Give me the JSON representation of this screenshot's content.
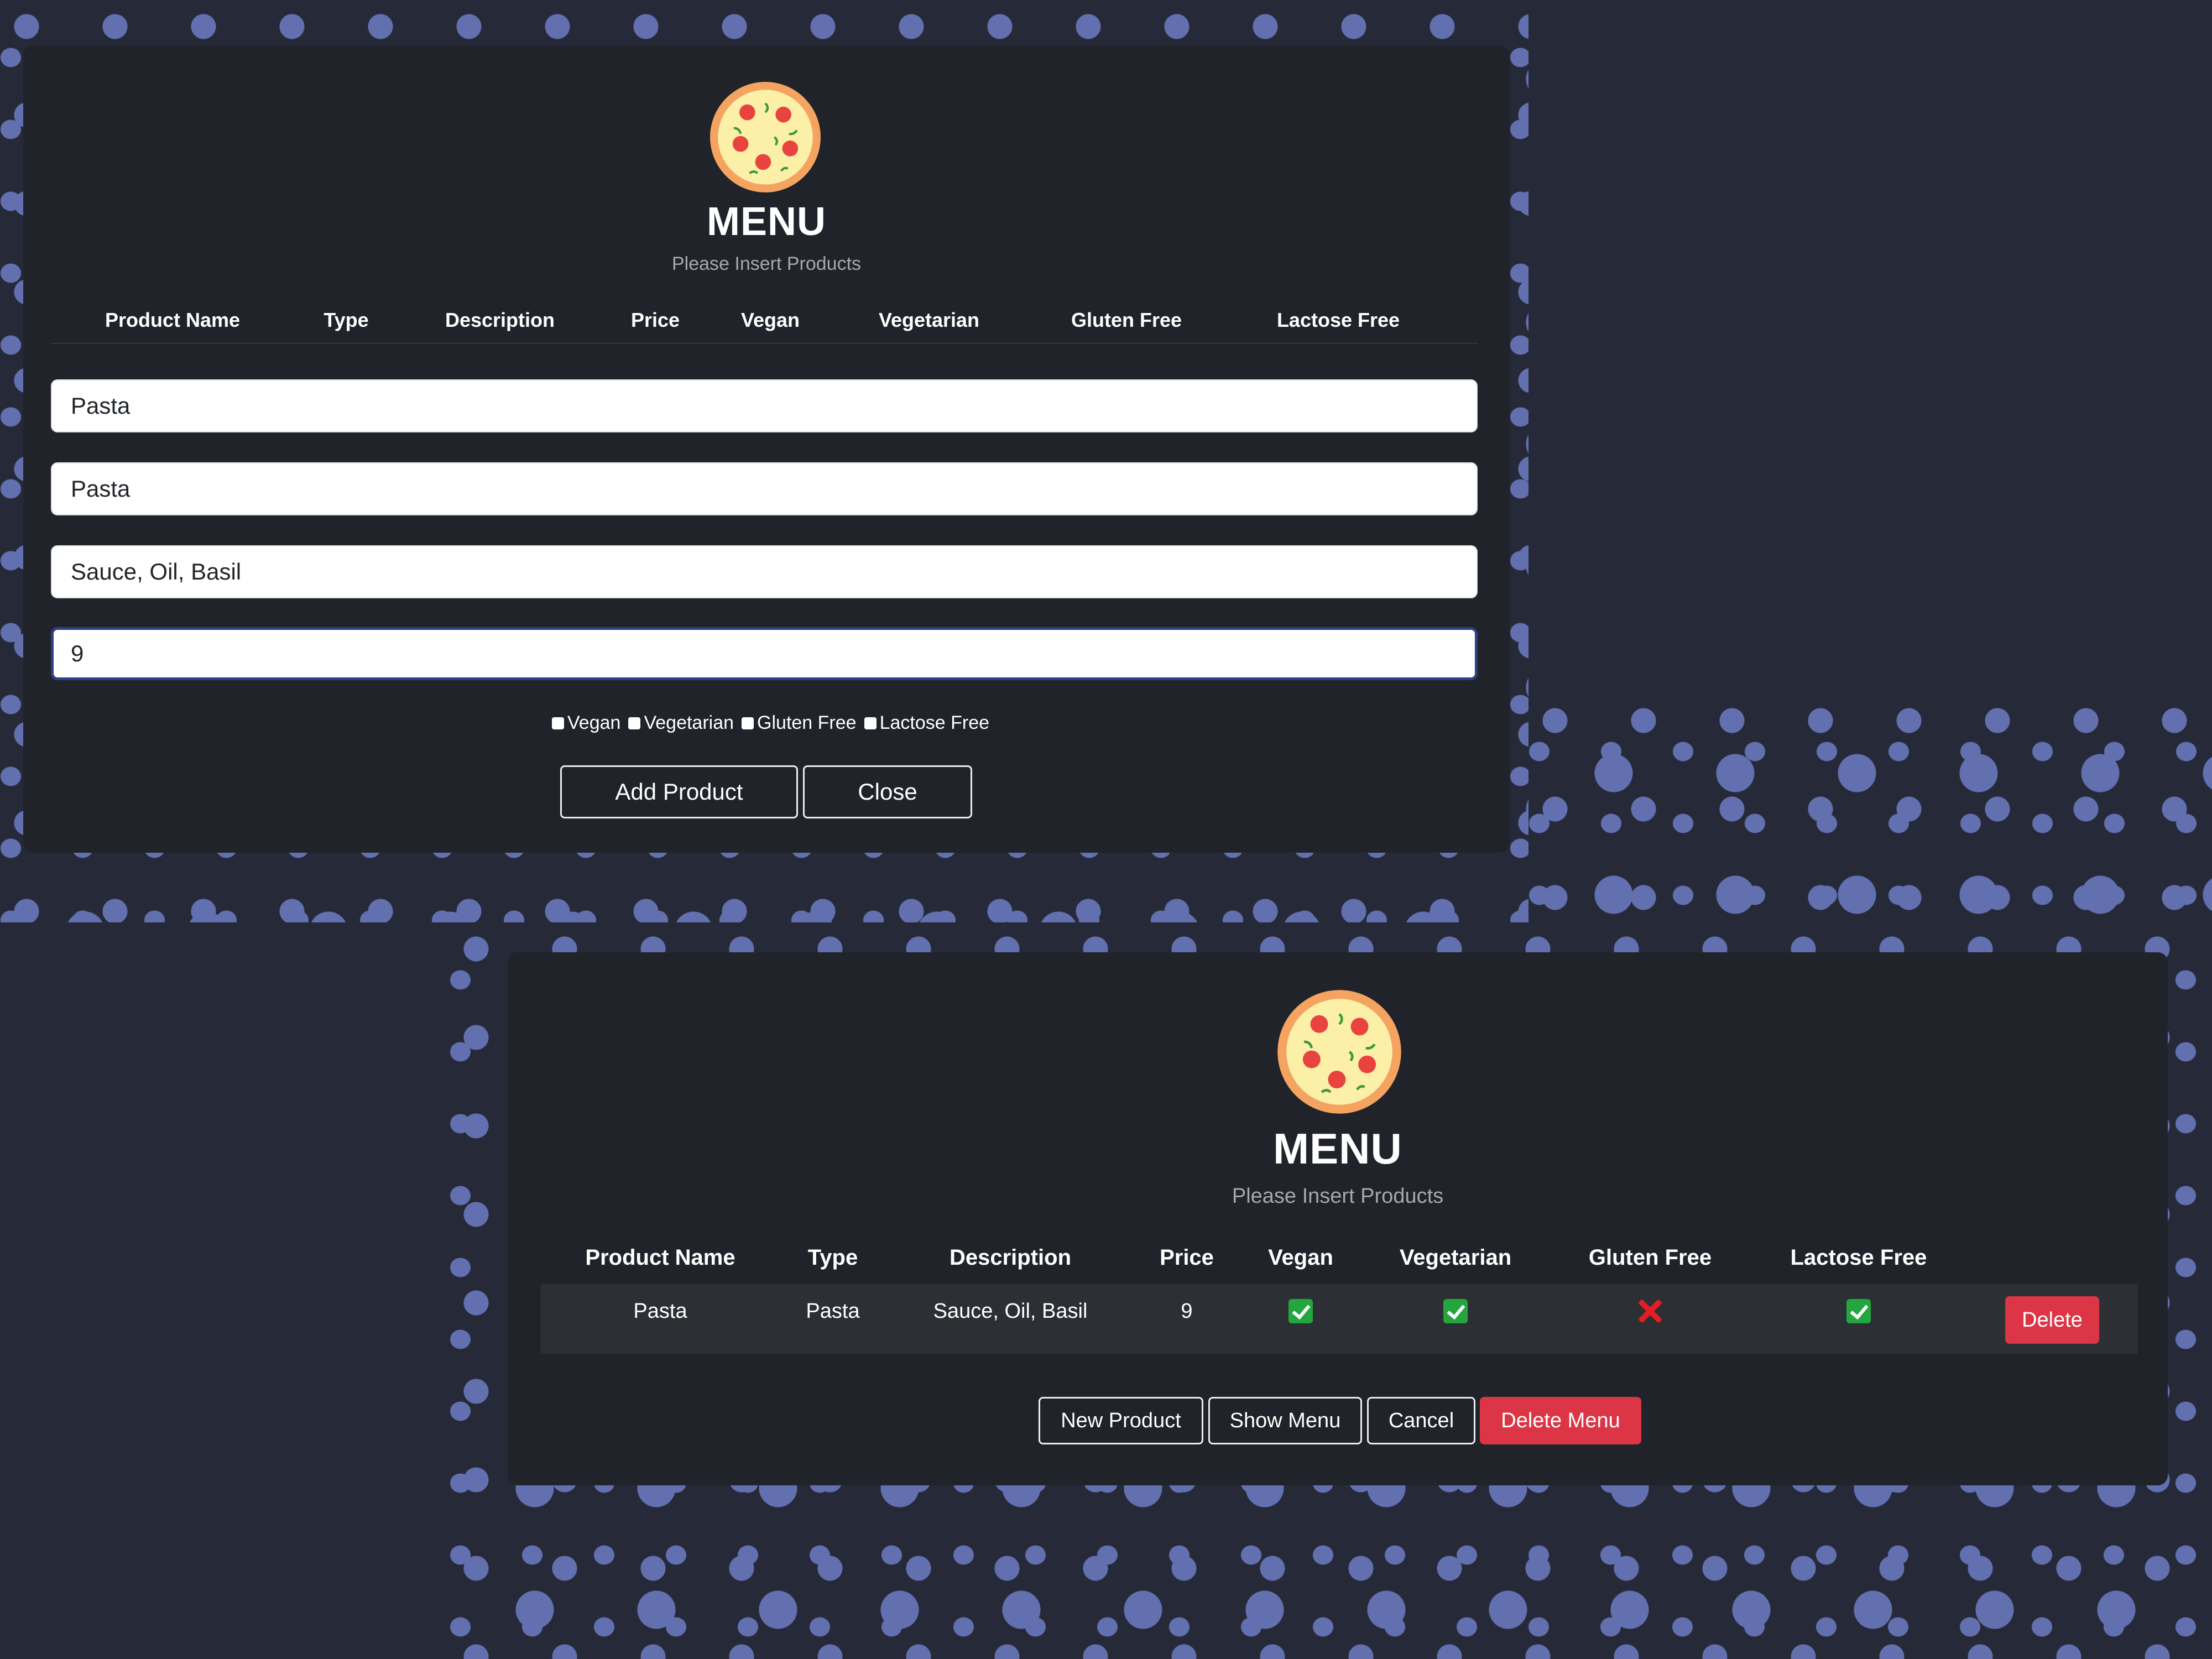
{
  "colors": {
    "page_background": "#262a38",
    "pattern": "#6270b0",
    "card": "#202329",
    "danger": "#dc3545",
    "focus_border": "#2e3f86",
    "check_green": "#24a63f",
    "cross_red": "#e31e24"
  },
  "add_form": {
    "logo_icon": "pizza-icon",
    "title": "MENU",
    "subtitle": "Please Insert Products",
    "headers": [
      "Product Name",
      "Type",
      "Description",
      "Price",
      "Vegan",
      "Vegetarian",
      "Gluten Free",
      "Lactose Free"
    ],
    "inputs": {
      "product_name": "Pasta",
      "type": "Pasta",
      "description": "Sauce, Oil, Basil",
      "price": "9"
    },
    "checkboxes": [
      {
        "label": "Vegan",
        "checked": false
      },
      {
        "label": "Vegetarian",
        "checked": false
      },
      {
        "label": "Gluten Free",
        "checked": false
      },
      {
        "label": "Lactose Free",
        "checked": false
      }
    ],
    "add_button": "Add Product",
    "close_button": "Close"
  },
  "menu_view": {
    "logo_icon": "pizza-icon",
    "title": "MENU",
    "subtitle": "Please Insert Products",
    "headers": [
      "Product Name",
      "Type",
      "Description",
      "Price",
      "Vegan",
      "Vegetarian",
      "Gluten Free",
      "Lactose Free"
    ],
    "rows": [
      {
        "product_name": "Pasta",
        "type": "Pasta",
        "description": "Sauce, Oil, Basil",
        "price": "9",
        "vegan": true,
        "vegetarian": true,
        "gluten_free": false,
        "lactose_free": true,
        "delete_label": "Delete"
      }
    ],
    "buttons": {
      "new_product": "New Product",
      "show_menu": "Show Menu",
      "cancel": "Cancel",
      "delete_menu": "Delete Menu"
    }
  }
}
